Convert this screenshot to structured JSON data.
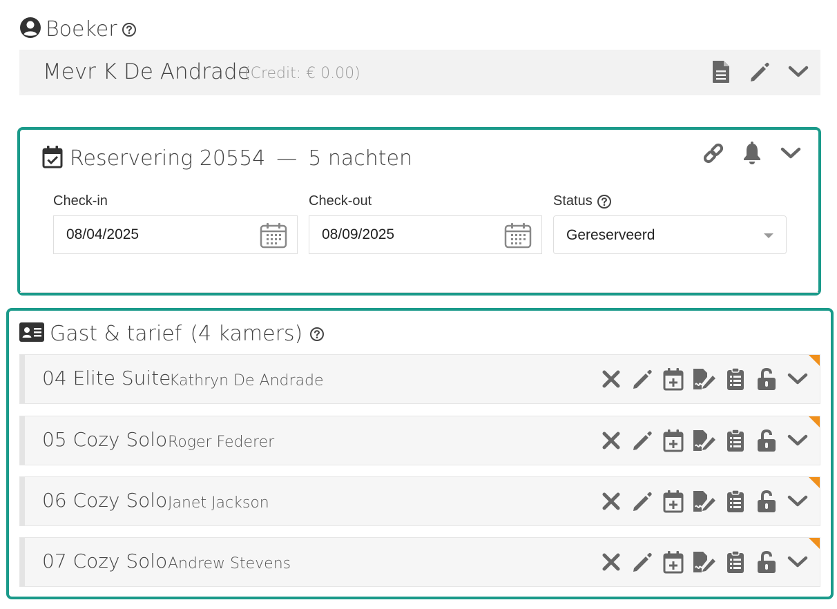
{
  "booker": {
    "title": "Boeker",
    "name": "Mevr K De Andrade",
    "credit": "(Credit: € 0.00)"
  },
  "reservation": {
    "title": "Reservering 20554",
    "separator": "—",
    "nights": "5 nachten",
    "checkin_label": "Check-in",
    "checkin_value": "08/04/2025",
    "checkout_label": "Check-out",
    "checkout_value": "08/09/2025",
    "status_label": "Status",
    "status_value": "Gereserveerd"
  },
  "guests": {
    "title": "Gast & tarief",
    "room_count": "(4 kamers)",
    "rows": [
      {
        "room": "04 Elite Suite",
        "guest": "Kathryn De Andrade"
      },
      {
        "room": "05 Cozy Solo",
        "guest": "Roger Federer"
      },
      {
        "room": "06 Cozy Solo",
        "guest": "Janet Jackson"
      },
      {
        "room": "07 Cozy Solo",
        "guest": "Andrew Stevens"
      }
    ]
  },
  "colors": {
    "accent_border": "#1a9a8a",
    "corner_flag": "#f0901c",
    "icon": "#666666"
  },
  "icons": {
    "booker": "user-circle-icon",
    "help": "question-circle-icon",
    "document": "document-icon",
    "edit": "pencil-icon",
    "expand": "chevron-down-icon",
    "calendar_check": "calendar-check-icon",
    "link": "link-icon",
    "bell": "bell-icon",
    "id_card": "id-card-icon",
    "remove": "x-icon",
    "calendar_plus": "calendar-plus-icon",
    "signature": "signature-icon",
    "clipboard": "clipboard-list-icon",
    "unlock": "unlock-icon"
  }
}
